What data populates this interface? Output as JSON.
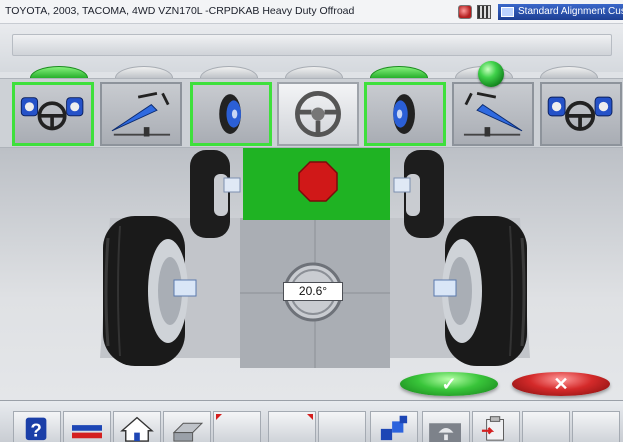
{
  "window": {
    "title": "TOYOTA, 2003, TACOMA, 4WD VZN170L -CRPDKAB Heavy Duty Offroad",
    "mode_label": "Standard Alignment Cus"
  },
  "procedure": {
    "steps": [
      {
        "icon": "steering-wheel-heads-icon",
        "state": "complete"
      },
      {
        "icon": "level-heads-icon",
        "state": "pending"
      },
      {
        "icon": "wheel-caster-swing-icon",
        "state": "complete"
      },
      {
        "icon": "steering-wheel-icon",
        "state": "current"
      },
      {
        "icon": "wheel-caster-swing-icon",
        "state": "complete"
      },
      {
        "icon": "level-heads-icon",
        "state": "pending"
      },
      {
        "icon": "steering-wheel-heads-icon",
        "state": "pending"
      }
    ],
    "status_light_color": "#2dc238"
  },
  "main": {
    "stop_indicator_icon": "stop-sign-icon",
    "steering_angle": "20.6°"
  },
  "actions": {
    "ok_glyph": "✓",
    "cancel_glyph": "✕"
  },
  "toolbar": {
    "buttons": [
      {
        "icon": "help-icon"
      },
      {
        "icon": "vehicle-specs-icon"
      },
      {
        "icon": "home-icon"
      },
      {
        "icon": "print-icon"
      },
      {
        "icon": "blank-icon"
      },
      {
        "icon": "blank-icon"
      },
      {
        "icon": "blank-icon"
      },
      {
        "icon": "sensor-setup-icon"
      },
      {
        "icon": "vehicle-lift-icon"
      },
      {
        "icon": "report-icon"
      },
      {
        "icon": "blank-icon"
      },
      {
        "icon": "blank-icon"
      }
    ]
  },
  "colors": {
    "complete_border": "#3ee03c",
    "stop_red": "#d01818",
    "stop_panel_green": "#1fb323",
    "ok_green": "#39c53a",
    "cancel_red": "#d42a2a"
  }
}
